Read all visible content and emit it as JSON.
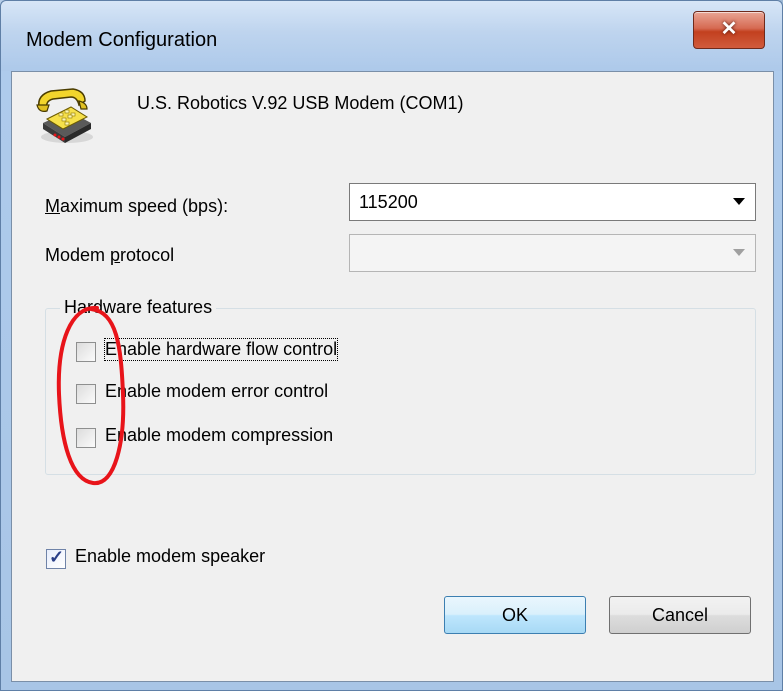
{
  "window": {
    "title": "Modem Configuration",
    "close_glyph": "✕"
  },
  "device": {
    "name": "U.S. Robotics V.92 USB Modem (COM1)",
    "icon": "telephone-icon"
  },
  "fields": {
    "max_speed": {
      "label": "Maximum speed (bps):",
      "value": "115200"
    },
    "protocol": {
      "label": "Modem protocol",
      "value": ""
    }
  },
  "hardware": {
    "title": "Hardware features",
    "options": [
      {
        "label": "Enable hardware flow control",
        "checked": false
      },
      {
        "label": "Enable modem error control",
        "checked": false
      },
      {
        "label": "Enable modem compression",
        "checked": false
      }
    ]
  },
  "speaker": {
    "label": "Enable modem speaker",
    "checked": true,
    "check_glyph": "✓"
  },
  "buttons": {
    "ok": "OK",
    "cancel": "Cancel"
  },
  "colors": {
    "annotation": "#e8141a",
    "close_button": "#c2401f"
  }
}
